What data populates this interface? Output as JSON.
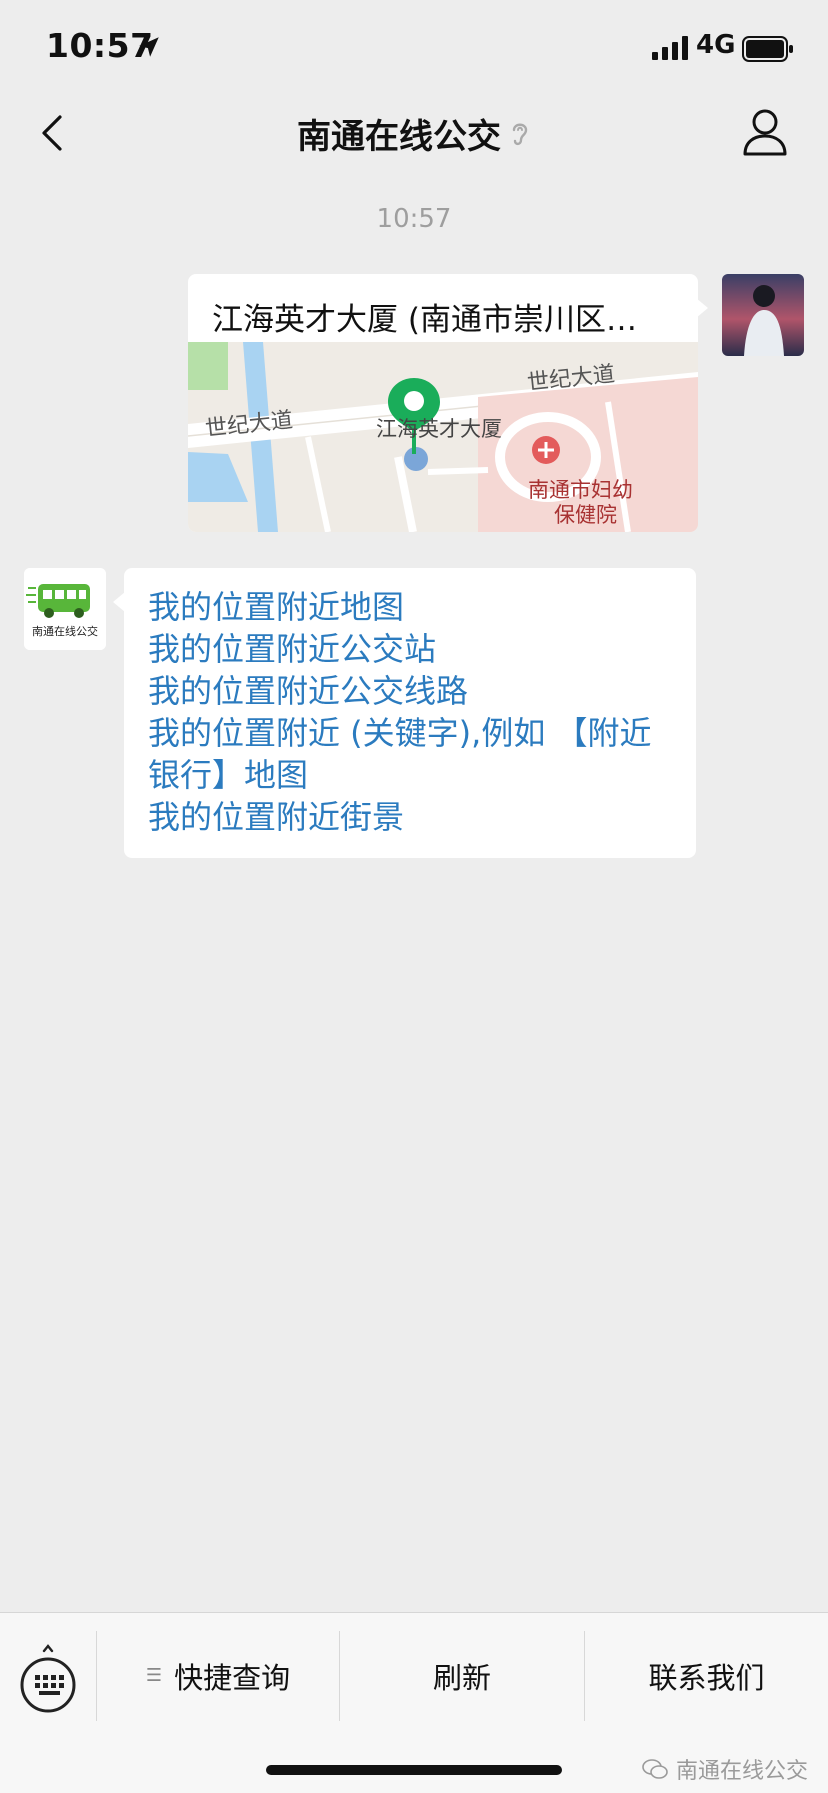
{
  "status_bar": {
    "time": "10:57",
    "network": "4G"
  },
  "header": {
    "title": "南通在线公交"
  },
  "chat": {
    "timestamp": "10:57",
    "location_message": {
      "title": "江海英才大厦 (南通市崇川区…",
      "map_labels": {
        "road_left": "世纪大道",
        "road_right": "世纪大道",
        "pin_label": "江海英才大厦",
        "hospital_line1": "南通市妇幼",
        "hospital_line2": "保健院"
      }
    },
    "bot_avatar_text": "南通在线公交",
    "menu_items": [
      "我的位置附近地图",
      "我的位置附近公交站",
      "我的位置附近公交线路",
      "我的位置附近 (关键字),例如 【附近银行】地图",
      "我的位置附近街景"
    ]
  },
  "bottom_menu": {
    "items": [
      "快捷查询",
      "刷新",
      "联系我们"
    ],
    "watermark": "南通在线公交"
  },
  "colors": {
    "link": "#2b7bbf",
    "pin_green": "#1aad5a",
    "background": "#ededed"
  }
}
